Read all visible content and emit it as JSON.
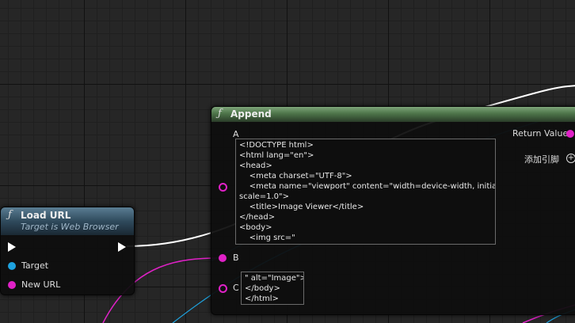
{
  "wire_colors": {
    "exec": "#ffffff",
    "string": "#e021c7",
    "object": "#1ea3e0"
  },
  "load_url_node": {
    "icon": "function-icon",
    "title": "Load URL",
    "subtitle": "Target is Web Browser",
    "pins": {
      "target": "Target",
      "new_url": "New URL"
    }
  },
  "append_node": {
    "icon": "function-icon",
    "title": "Append",
    "pin_a": "A",
    "pin_b": "B",
    "pin_c": "C",
    "return_value": "Return Value",
    "add_pin": "添加引脚",
    "a_lines": [
      "<!DOCTYPE html>",
      "<html lang=\"en\">",
      "<head>",
      "    <meta charset=\"UTF-8\">",
      "    <meta name=\"viewport\" content=\"width=device-width, initial-",
      "scale=1.0\">",
      "    <title>Image Viewer</title>",
      "</head>",
      "<body>",
      "    <img src=\""
    ],
    "c_lines": [
      "\" alt=\"Image\">",
      "</body>",
      "</html>"
    ]
  }
}
